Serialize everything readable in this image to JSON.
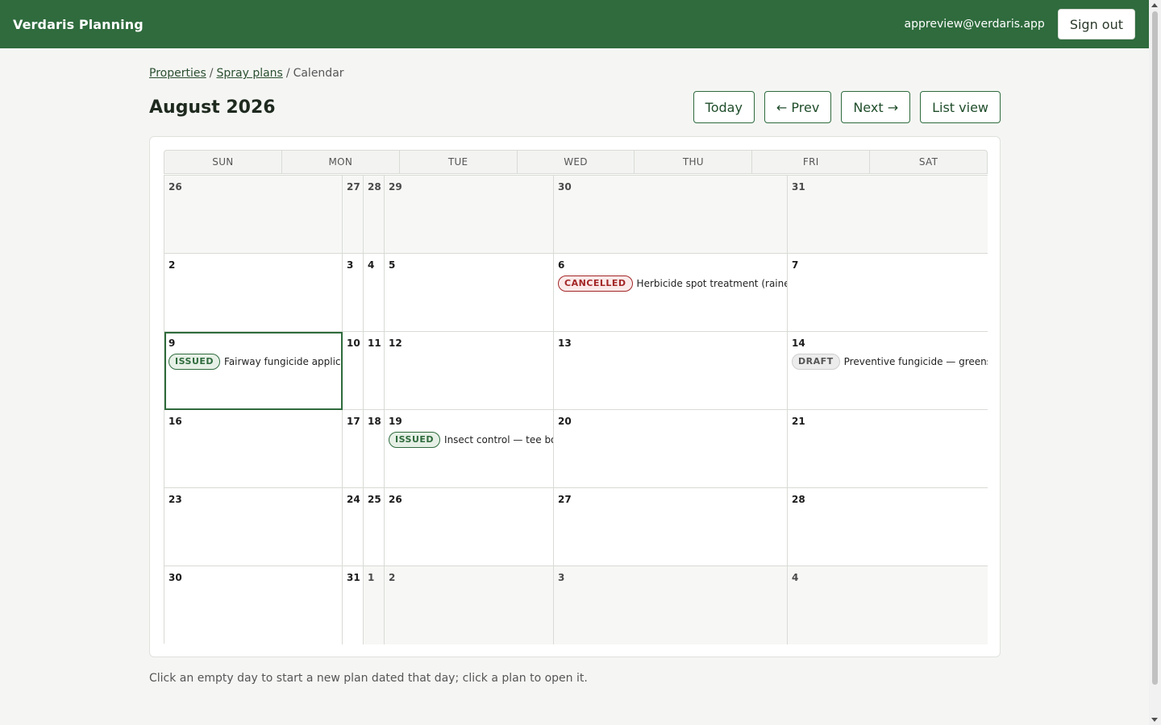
{
  "app": {
    "title": "Verdaris Planning",
    "user_email": "appreview@verdaris.app",
    "sign_out_label": "Sign out"
  },
  "breadcrumb": {
    "properties": "Properties",
    "spray_plans": "Spray plans",
    "current": "Calendar",
    "sep": "/"
  },
  "page": {
    "title": "August 2026"
  },
  "nav": {
    "today": "Today",
    "prev": "← Prev",
    "next": "Next →",
    "list_view": "List view"
  },
  "weekdays": [
    "SUN",
    "MON",
    "TUE",
    "WED",
    "THU",
    "FRI",
    "SAT"
  ],
  "calendar": {
    "rows": [
      [
        {
          "day": "26",
          "out": true
        },
        {
          "day": "27",
          "out": true
        },
        {
          "day": "28",
          "out": true
        },
        {
          "day": "29",
          "out": true
        },
        {
          "day": "30",
          "out": true
        },
        {
          "day": "31",
          "out": true
        }
      ],
      [
        {
          "day": "2"
        },
        {
          "day": "3"
        },
        {
          "day": "4"
        },
        {
          "day": "5"
        },
        {
          "day": "6",
          "event": {
            "status": "CANCELLED",
            "kind": "cancelled",
            "title": "Herbicide spot treatment (rained out)"
          }
        },
        {
          "day": "7"
        }
      ],
      [
        {
          "day": "9",
          "today": true,
          "event": {
            "status": "ISSUED",
            "kind": "issued",
            "title": "Fairway fungicide application"
          }
        },
        {
          "day": "10"
        },
        {
          "day": "11"
        },
        {
          "day": "12"
        },
        {
          "day": "13"
        },
        {
          "day": "14",
          "event": {
            "status": "DRAFT",
            "kind": "draft",
            "title": "Preventive fungicide — greens pack"
          }
        }
      ],
      [
        {
          "day": "16"
        },
        {
          "day": "17"
        },
        {
          "day": "18"
        },
        {
          "day": "19",
          "event": {
            "status": "ISSUED",
            "kind": "issued",
            "title": "Insect control — tee boxes"
          }
        },
        {
          "day": "20"
        },
        {
          "day": "21"
        }
      ],
      [
        {
          "day": "23"
        },
        {
          "day": "24"
        },
        {
          "day": "25"
        },
        {
          "day": "26"
        },
        {
          "day": "27"
        },
        {
          "day": "28"
        }
      ],
      [
        {
          "day": "30"
        },
        {
          "day": "31"
        },
        {
          "day": "1",
          "out": true
        },
        {
          "day": "2",
          "out": true
        },
        {
          "day": "3",
          "out": true
        },
        {
          "day": "4",
          "out": true
        }
      ]
    ]
  },
  "footnote": "Click an empty day to start a new plan dated that day; click a plan to open it.",
  "colors": {
    "brand": "#2f6b3d",
    "issued": "#2f6b3d",
    "cancelled": "#a32626",
    "draft": "#555555"
  }
}
